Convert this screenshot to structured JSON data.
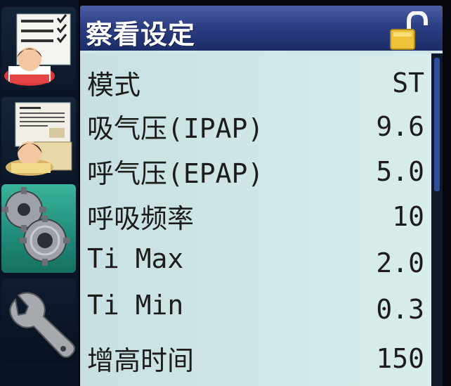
{
  "header": {
    "title": "察看设定",
    "lock_icon": "unlocked-padlock-icon"
  },
  "sidebar": {
    "items": [
      {
        "name": "patient-report",
        "icon": "patient-checklist-icon",
        "selected": false
      },
      {
        "name": "patient-info",
        "icon": "patient-document-icon",
        "selected": false
      },
      {
        "name": "settings",
        "icon": "gears-icon",
        "selected": true
      },
      {
        "name": "tools",
        "icon": "wrench-icon",
        "selected": false
      }
    ]
  },
  "settings": {
    "rows": [
      {
        "label": "模式",
        "value": "ST"
      },
      {
        "label": "吸气压(IPAP)",
        "value": "9.6"
      },
      {
        "label": "呼气压(EPAP)",
        "value": "5.0"
      },
      {
        "label": "呼吸频率",
        "value": "10"
      },
      {
        "label": "Ti Max",
        "value": "2.0"
      },
      {
        "label": "Ti Min",
        "value": "0.3"
      },
      {
        "label": "增高时间",
        "value": "150"
      }
    ]
  },
  "colors": {
    "title_bar": "#2c3f84",
    "panel_bg": "#cfe6e8",
    "selected_tab": "#1f8a78",
    "lock": "#f0c43a"
  }
}
